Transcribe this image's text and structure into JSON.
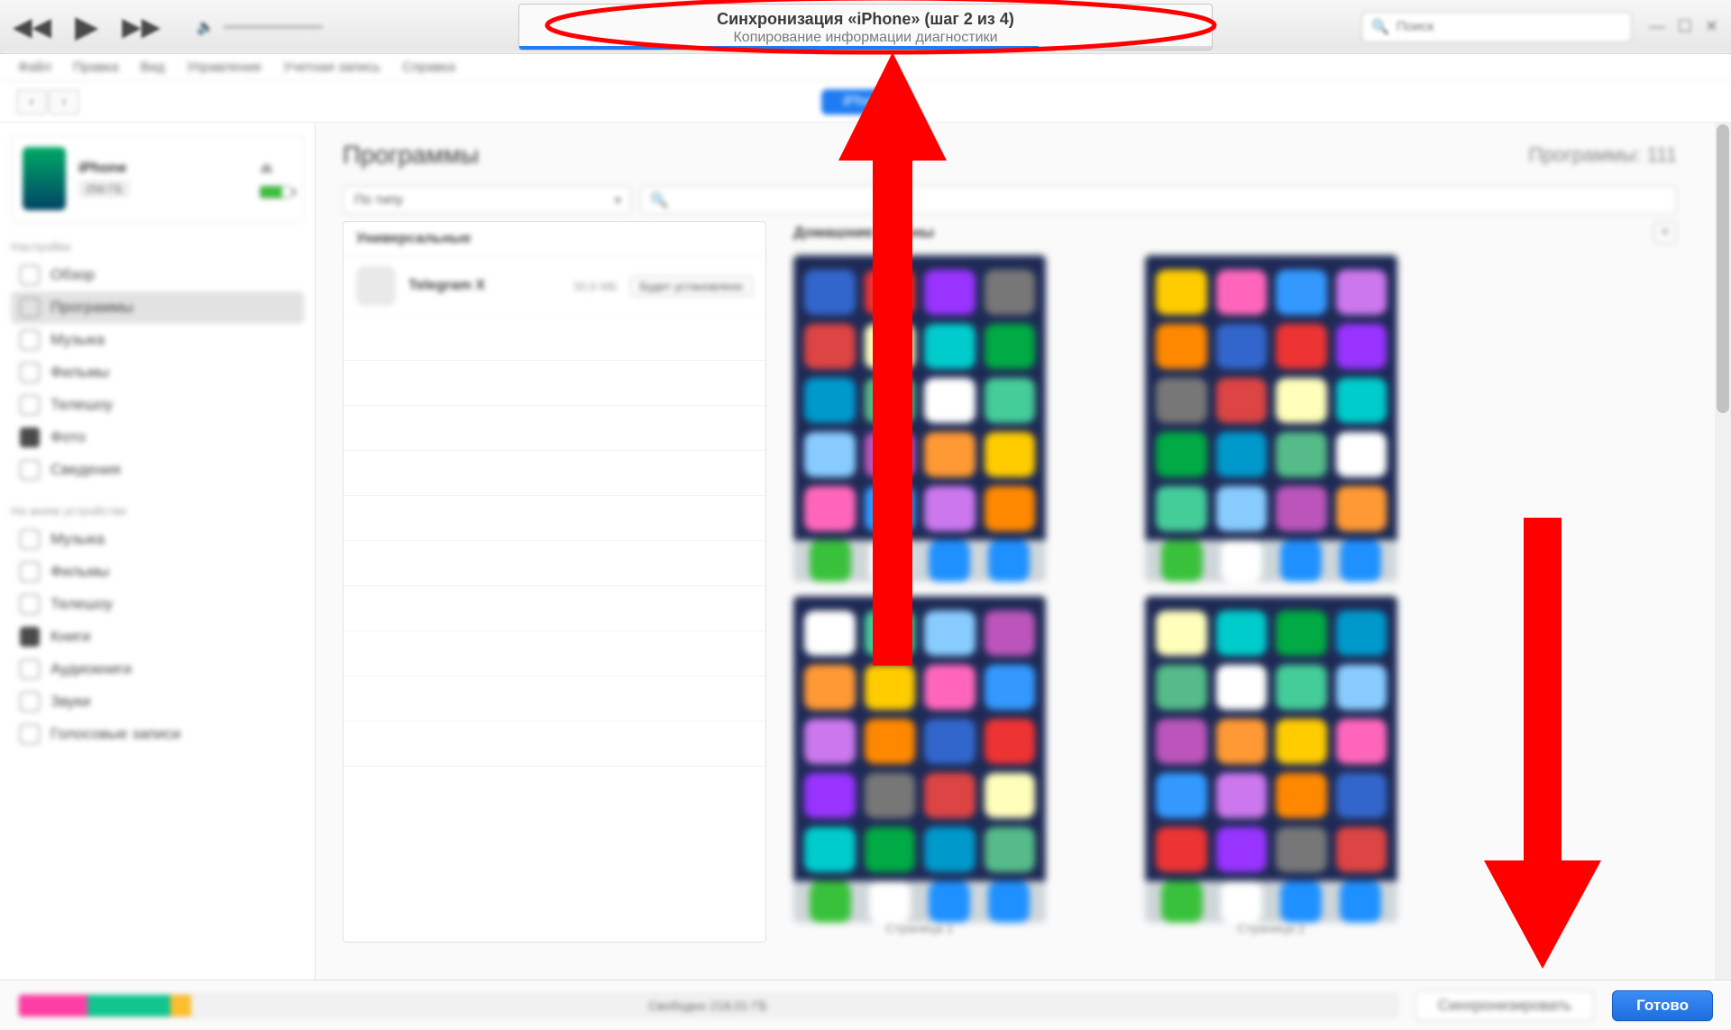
{
  "toolbar": {
    "lcd_title": "Синхронизация «iPhone» (шаг 2 из 4)",
    "lcd_subtitle": "Копирование информации диагностики",
    "search_placeholder": "Поиск"
  },
  "menubar": [
    "Файл",
    "Правка",
    "Вид",
    "Управление",
    "Учетная запись",
    "Справка"
  ],
  "navrow": {
    "device_pill": "iPhone"
  },
  "sidebar": {
    "device": {
      "name": "iPhone",
      "capacity": "256 ГБ"
    },
    "section1_header": "Настройки",
    "section1": [
      "Обзор",
      "Программы",
      "Музыка",
      "Фильмы",
      "Телешоу",
      "Фото",
      "Сведения"
    ],
    "section2_header": "На моем устройстве",
    "section2": [
      "Музыка",
      "Фильмы",
      "Телешоу",
      "Книги",
      "Аудиокниги",
      "Звуки",
      "Голосовые записи"
    ]
  },
  "main": {
    "title": "Программы",
    "count_label": "Программы: 111",
    "filter_select": "По типу",
    "apps_header": "Универсальные",
    "app_rows": [
      {
        "name": "Telegram X",
        "size": "50,6 МБ",
        "action": "Будет установлено"
      }
    ],
    "screens_header": "Домашние экраны",
    "screen_labels": [
      "",
      "",
      "Страница 1",
      "Страница 2"
    ]
  },
  "footer": {
    "capacity_label": "Свободно 218,01 ГБ",
    "sync_label": "Синхронизировать",
    "done_label": "Готово"
  },
  "colors": {
    "accent": "#1e7cf2",
    "annotation": "#ff0000"
  }
}
